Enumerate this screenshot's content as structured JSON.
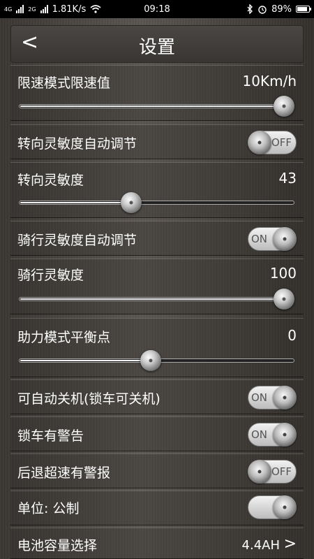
{
  "status_bar": {
    "network_1": "4G",
    "network_2": "2G",
    "speed": "1.81K/s",
    "time": "09:18",
    "battery": "89%",
    "battery_level": 0.89
  },
  "header": {
    "back_symbol": "<",
    "title": "设置"
  },
  "settings": {
    "speed_limit": {
      "label": "限速模式限速值",
      "value": "10Km/h",
      "level": 1.0
    },
    "steering_auto": {
      "label": "转向灵敏度自动调节",
      "toggle": "OFF",
      "on": false
    },
    "steering_sensitivity": {
      "label": "转向灵敏度",
      "value": "43",
      "level": 0.41
    },
    "riding_auto": {
      "label": "骑行灵敏度自动调节",
      "toggle": "ON",
      "on": true
    },
    "riding_sensitivity": {
      "label": "骑行灵敏度",
      "value": "100",
      "level": 1.0
    },
    "assist_balance": {
      "label": "助力模式平衡点",
      "value": "0",
      "level": 0.48
    },
    "auto_shutdown": {
      "label": "可自动关机(锁车可关机)",
      "toggle": "ON",
      "on": true
    },
    "lock_warning": {
      "label": "锁车有警告",
      "toggle": "ON",
      "on": true
    },
    "reverse_overspeed": {
      "label": "后退超速有警报",
      "toggle": "OFF",
      "on": false
    },
    "unit": {
      "label": "单位: 公制",
      "toggle": "",
      "on": true
    },
    "battery_capacity": {
      "label": "电池容量选择",
      "value": "4.4AH",
      "chevron": ">"
    }
  },
  "colors": {
    "background": "#4a4540",
    "status_bar": "#000000",
    "text": "#ffffff"
  },
  "icons": [
    "signal-icon",
    "wifi-icon",
    "bluetooth-icon",
    "alarm-icon",
    "battery-icon",
    "back-icon",
    "chevron-right-icon"
  ]
}
